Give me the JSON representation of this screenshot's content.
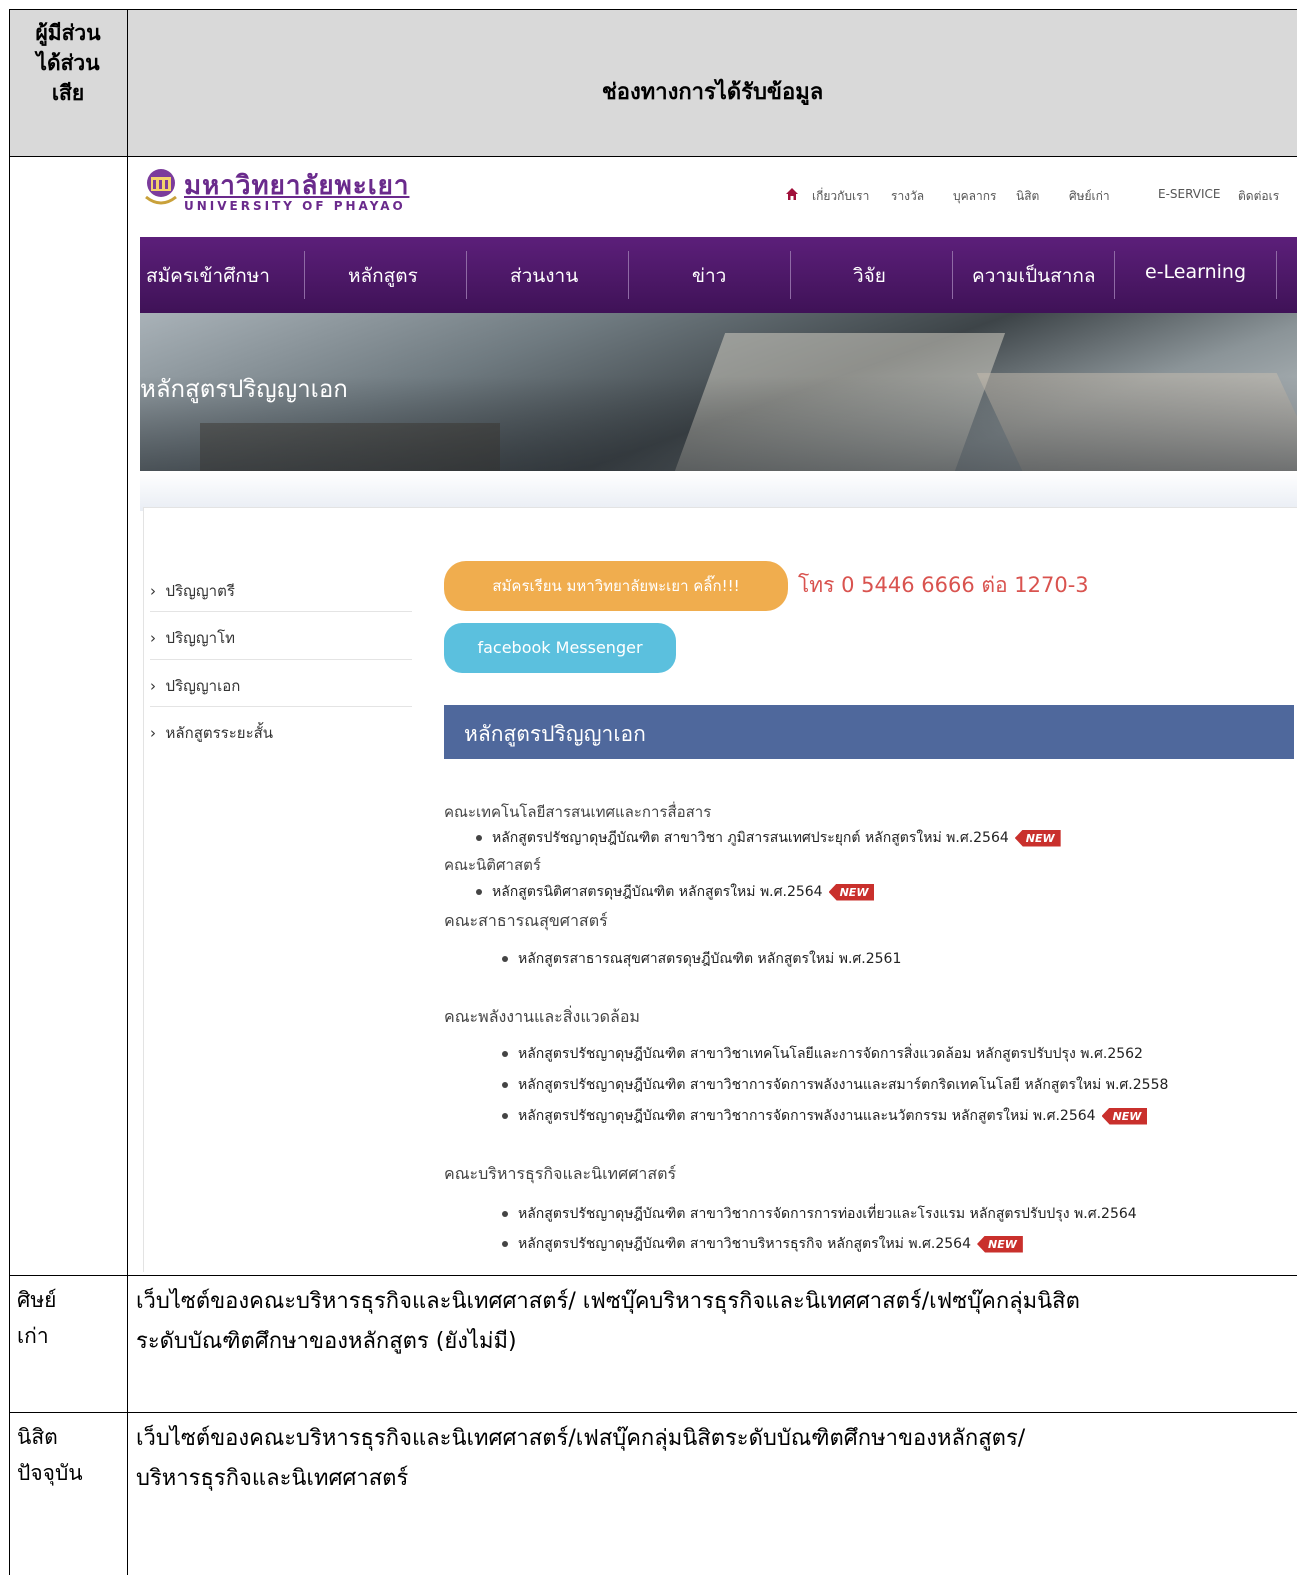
{
  "table": {
    "header_left": "ผู้มีส่วนได้ส่วนเสีย",
    "header_left_lines": [
      "ผู้มีส่วน",
      "ได้ส่วน",
      "เสีย"
    ],
    "header_main": "ช่องทางการได้รับข้อมูล",
    "rows": [
      {
        "label_lines": [
          "ศิษย์",
          "เก่า"
        ],
        "text_lines": [
          "เว็บไซต์ของคณะบริหารธุรกิจและนิเทศศาสตร์/ เฟซบุ๊คบริหารธุรกิจและนิเทศศาสตร์/เฟซบุ๊คกลุ่มนิสิต",
          "ระดับบัณฑิตศึกษาของหลักสูตร (ยังไม่มี)"
        ]
      },
      {
        "label_lines": [
          "นิสิต",
          "ปัจจุบัน"
        ],
        "text_lines": [
          "เว็บไซต์ของคณะบริหารธุรกิจและนิเทศศาสตร์/เฟสบุ๊คกลุ่มนิสิตระดับบัณฑิตศึกษาของหลักสูตร/",
          "บริหารธุรกิจและนิเทศศาสตร์"
        ]
      }
    ]
  },
  "website": {
    "logo_th": "มหาวิทยาลัยพะเยา",
    "logo_en": "UNIVERSITY OF PHAYAO",
    "home_icon": "home-icon",
    "top_links": [
      "เกี่ยวกับเรา",
      "รางวัล",
      "บุคลากร",
      "นิสิต",
      "ศิษย์เก่า",
      "E-SERVICE",
      "ติดต่อเร"
    ],
    "main_nav": [
      "สมัครเข้าศึกษา",
      "หลักสูตร",
      "ส่วนงาน",
      "ข่าว",
      "วิจัย",
      "ความเป็นสากล",
      "e-Learning"
    ],
    "banner_title": "หลักสูตรปริญญาเอก",
    "sidebar": [
      "ปริญญาตรี",
      "ปริญญาโท",
      "ปริญญาเอก",
      "หลักสูตรระยะสั้น"
    ],
    "apply_button": "สมัครเรียน มหาวิทยาลัยพะเยา คลิ๊ก!!!",
    "phone": "โทร 0 5446 6666 ต่อ 1270-3",
    "fb_button": "facebook Messenger",
    "section_title": "หลักสูตรปริญญาเอก",
    "new_badge": "NEW",
    "faculties": [
      {
        "name": "คณะเทคโนโลยีสารสนเทศและการสื่อสาร",
        "programs": [
          {
            "name": "หลักสูตรปรัชญาดุษฎีบัณฑิต สาขาวิชา ภูมิสารสนเทศประยุกต์ หลักสูตรใหม่ พ.ศ.2564",
            "new": true
          }
        ]
      },
      {
        "name": "คณะนิติศาสตร์",
        "programs": [
          {
            "name": "หลักสูตรนิติศาสตรดุษฎีบัณฑิต หลักสูตรใหม่ พ.ศ.2564",
            "new": true
          }
        ]
      },
      {
        "name": "คณะสาธารณสุขศาสตร์",
        "programs": [
          {
            "name": "หลักสูตรสาธารณสุขศาสตรดุษฎีบัณฑิต หลักสูตรใหม่ พ.ศ.2561",
            "new": false
          }
        ]
      },
      {
        "name": "คณะพลังงานและสิ่งแวดล้อม",
        "programs": [
          {
            "name": "หลักสูตรปรัชญาดุษฎีบัณฑิต สาขาวิชาเทคโนโลยีและการจัดการสิ่งแวดล้อม หลักสูตรปรับปรุง พ.ศ.2562",
            "new": false
          },
          {
            "name": "หลักสูตรปรัชญาดุษฎีบัณฑิต สาขาวิชาการจัดการพลังงานและสมาร์ตกริดเทคโนโลยี หลักสูตรใหม่ พ.ศ.2558",
            "new": false
          },
          {
            "name": "หลักสูตรปรัชญาดุษฎีบัณฑิต สาขาวิชาการจัดการพลังงานและนวัตกรรม หลักสูตรใหม่ พ.ศ.2564",
            "new": true
          }
        ]
      },
      {
        "name": "คณะบริหารธุรกิจและนิเทศศาสตร์",
        "programs": [
          {
            "name": "หลักสูตรปรัชญาดุษฎีบัณฑิต สาขาวิชาการจัดการการท่องเที่ยวและโรงแรม หลักสูตรปรับปรุง พ.ศ.2564",
            "new": false
          },
          {
            "name": "หลักสูตรปรัชญาดุษฎีบัณฑิต สาขาวิชาบริหารธุรกิจ หลักสูตรใหม่ พ.ศ.2564",
            "new": true
          }
        ]
      }
    ]
  },
  "colors": {
    "header_bg": "#d9d9d9",
    "purple_nav": "#4b1767",
    "apply_button": "#f0ad4e",
    "fb_button": "#5bc0de",
    "section_head": "#4f689c",
    "phone_text": "#d9534f",
    "new_badge": "#c9302c"
  }
}
